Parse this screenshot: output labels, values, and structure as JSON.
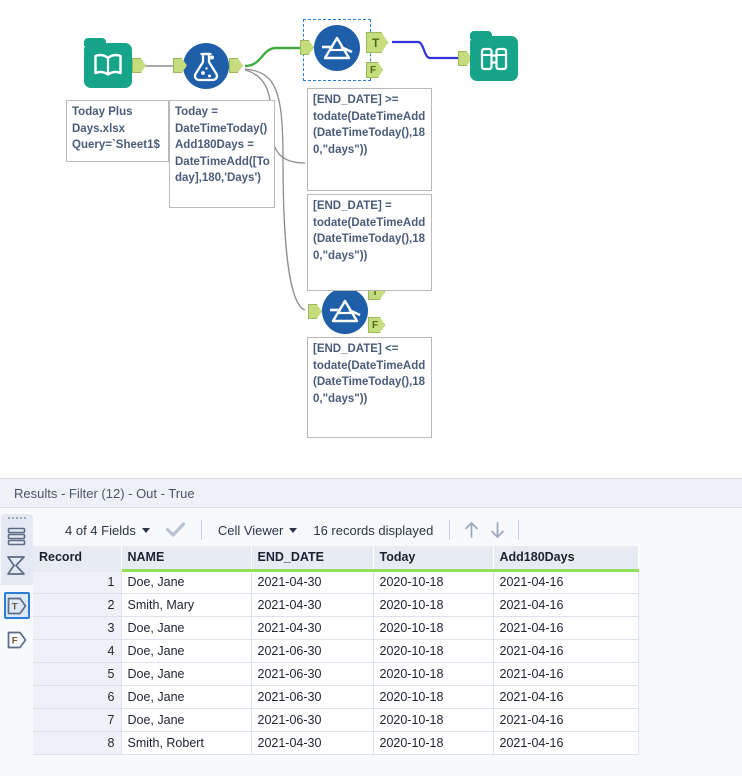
{
  "canvas": {
    "tools": [
      {
        "id": "input-data",
        "label": "input-data-tool",
        "icon": "book-icon"
      },
      {
        "id": "formula",
        "label": "formula-tool",
        "icon": "flask-icon"
      },
      {
        "id": "filter-1",
        "label": "filter-tool-selected",
        "icon": "filter-icon",
        "true_anchor": "T",
        "false_anchor": "F",
        "selected": true
      },
      {
        "id": "filter-2",
        "label": "filter-tool",
        "icon": "filter-icon",
        "true_anchor": "T",
        "false_anchor": "F",
        "selected": false
      },
      {
        "id": "browse",
        "label": "browse-tool",
        "icon": "binoculars-icon"
      }
    ],
    "annotations": [
      {
        "id": "input-annotation",
        "text": "Today Plus Days.xlsx Query=`Sheet1$"
      },
      {
        "id": "formula-annotation",
        "text": "Today = DateTimeToday()\nAdd180Days = DateTimeAdd([Today],180,'Days')"
      },
      {
        "id": "filter1-annotation",
        "text": "[END_DATE] >= todate(DateTimeAdd(DateTimeToday(),180,\"days\"))"
      },
      {
        "id": "filter2-annotation",
        "text": "[END_DATE] = todate(DateTimeAdd(DateTimeToday(),180,\"days\"))"
      },
      {
        "id": "filter3-annotation",
        "text": "[END_DATE] <= todate(DateTimeAdd(DateTimeToday(),180,\"days\"))"
      }
    ],
    "colors": {
      "teal_tool": "#17a589",
      "blue_tool": "#1f5fa9",
      "anchor_green": "#c5dd7d",
      "wire_highlight": "#3faa3f",
      "wire_selected": "#3333dd",
      "wire_default": "#8d8d8d",
      "selection_border": "#2a7fd4"
    }
  },
  "results": {
    "title": "Results - Filter (12) - Out - True",
    "rail": {
      "grid_icon": "grid-icon",
      "input_anchor_icon": "input-anchor-icon",
      "true_anchor_label": "T",
      "false_anchor_label": "F"
    },
    "toolbar": {
      "fields_label": "4 of 4 Fields",
      "check_icon": "checkmark-icon",
      "cell_viewer_label": "Cell Viewer",
      "records_label": "16 records displayed",
      "up_icon": "arrow-up-icon",
      "down_icon": "arrow-down-icon"
    },
    "table": {
      "columns": [
        "Record",
        "NAME",
        "END_DATE",
        "Today",
        "Add180Days"
      ],
      "rows": [
        [
          "1",
          "Doe, Jane",
          "2021-04-30",
          "2020-10-18",
          "2021-04-16"
        ],
        [
          "2",
          "Smith, Mary",
          "2021-04-30",
          "2020-10-18",
          "2021-04-16"
        ],
        [
          "3",
          "Doe, Jane",
          "2021-04-30",
          "2020-10-18",
          "2021-04-16"
        ],
        [
          "4",
          "Doe, Jane",
          "2021-06-30",
          "2020-10-18",
          "2021-04-16"
        ],
        [
          "5",
          "Doe, Jane",
          "2021-06-30",
          "2020-10-18",
          "2021-04-16"
        ],
        [
          "6",
          "Doe, Jane",
          "2021-06-30",
          "2020-10-18",
          "2021-04-16"
        ],
        [
          "7",
          "Doe, Jane",
          "2021-06-30",
          "2020-10-18",
          "2021-04-16"
        ],
        [
          "8",
          "Smith, Robert",
          "2021-04-30",
          "2020-10-18",
          "2021-04-16"
        ]
      ]
    }
  }
}
